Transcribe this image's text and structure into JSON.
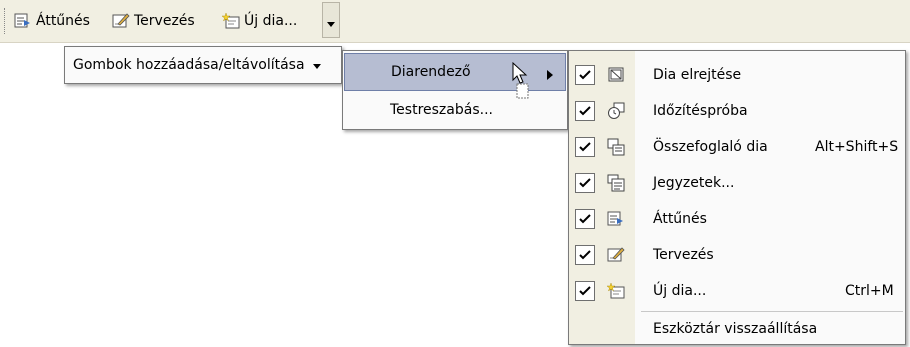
{
  "toolbar": {
    "items": [
      {
        "label": "Áttűnés",
        "icon": "slide-transition-icon"
      },
      {
        "label": "Tervezés",
        "icon": "design-icon"
      },
      {
        "label": "Új dia...",
        "icon": "new-slide-icon"
      }
    ],
    "overflow_icon": "chevron-down-icon"
  },
  "menu_level1": {
    "label": "Gombok hozzáadása/eltávolítása",
    "arrow_icon": "triangle-down-icon"
  },
  "menu_level2": {
    "items": [
      {
        "label": "Diarendező",
        "selected": true,
        "has_submenu": true
      },
      {
        "label": "Testreszabás..."
      }
    ]
  },
  "menu_level3": {
    "items": [
      {
        "label": "Dia elrejtése",
        "checked": true,
        "icon": "hide-slide-icon",
        "shortcut": ""
      },
      {
        "label": "Időzítéspróba",
        "checked": true,
        "icon": "rehearse-timings-icon",
        "shortcut": ""
      },
      {
        "label": "Összefoglaló dia",
        "checked": true,
        "icon": "summary-slide-icon",
        "shortcut": "Alt+Shift+S"
      },
      {
        "label": "Jegyzetek...",
        "checked": true,
        "icon": "notes-icon",
        "shortcut": ""
      },
      {
        "label": "Áttűnés",
        "checked": true,
        "icon": "slide-transition-icon",
        "shortcut": ""
      },
      {
        "label": "Tervezés",
        "checked": true,
        "icon": "design-icon",
        "shortcut": ""
      },
      {
        "label": "Új dia...",
        "checked": true,
        "icon": "new-slide-icon",
        "shortcut": "Ctrl+M"
      }
    ],
    "reset_label": "Eszköztár visszaállítása"
  },
  "colors": {
    "toolbar_bg": "#f1efe2",
    "highlight": "#b6bdd2",
    "highlight_border": "#6f7fa8"
  }
}
